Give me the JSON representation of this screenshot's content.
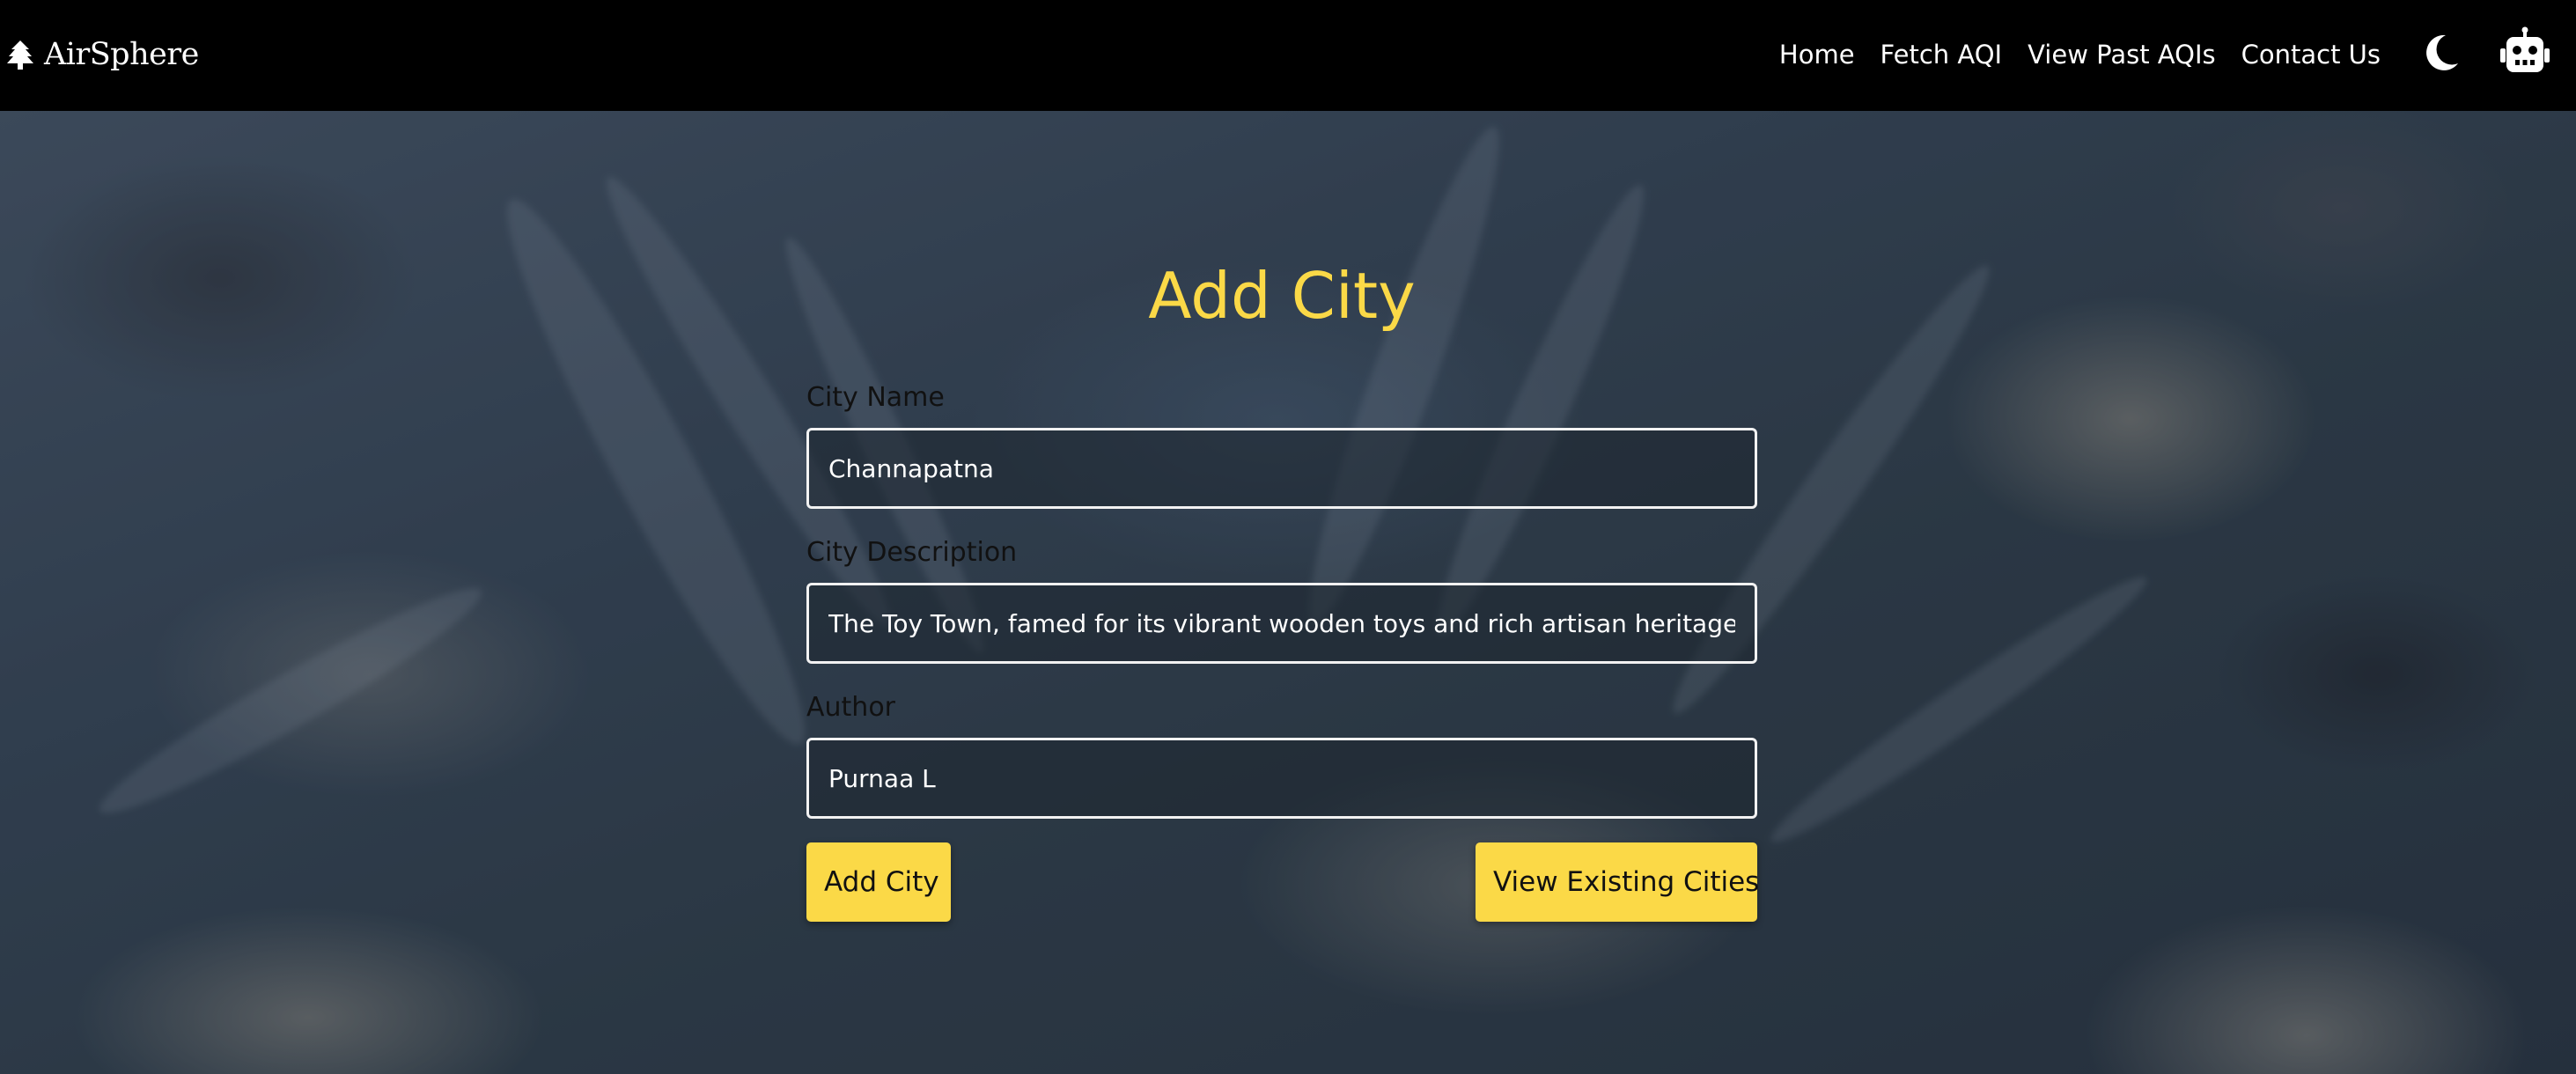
{
  "nav": {
    "brand": "AirSphere",
    "links": [
      "Home",
      "Fetch AQI",
      "View Past AQIs",
      "Contact Us"
    ],
    "icons": {
      "brand": "tree-icon",
      "theme": "moon-icon",
      "assistant": "robot-icon"
    }
  },
  "form": {
    "title": "Add City",
    "city_name": {
      "label": "City Name",
      "value": "Channapatna"
    },
    "city_description": {
      "label": "City Description",
      "value": "The Toy Town, famed for its vibrant wooden toys and rich artisan heritage."
    },
    "author": {
      "label": "Author",
      "value": "Purnaa L"
    },
    "submit_label": "Add City",
    "view_label": "View Existing Cities"
  },
  "colors": {
    "accent": "#fbd947",
    "navbar": "#000000",
    "input_border": "#f2f2f2"
  }
}
